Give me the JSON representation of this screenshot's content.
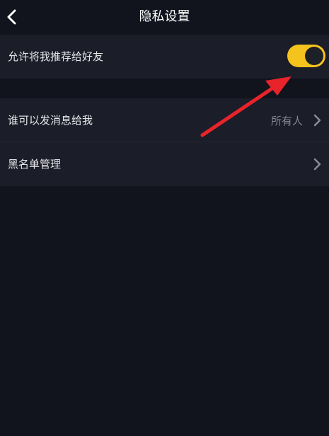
{
  "navbar": {
    "title": "隐私设置",
    "back_icon": "chevron-left-icon"
  },
  "privacy": {
    "recommend_label": "允许将我推荐给好友",
    "recommend_enabled": true,
    "toggle_color": "#f4c31d"
  },
  "messages": {
    "label": "谁可以发消息给我",
    "value": "所有人"
  },
  "blacklist": {
    "label": "黑名单管理"
  },
  "annotation": {
    "arrow_color": "#e8242a"
  }
}
